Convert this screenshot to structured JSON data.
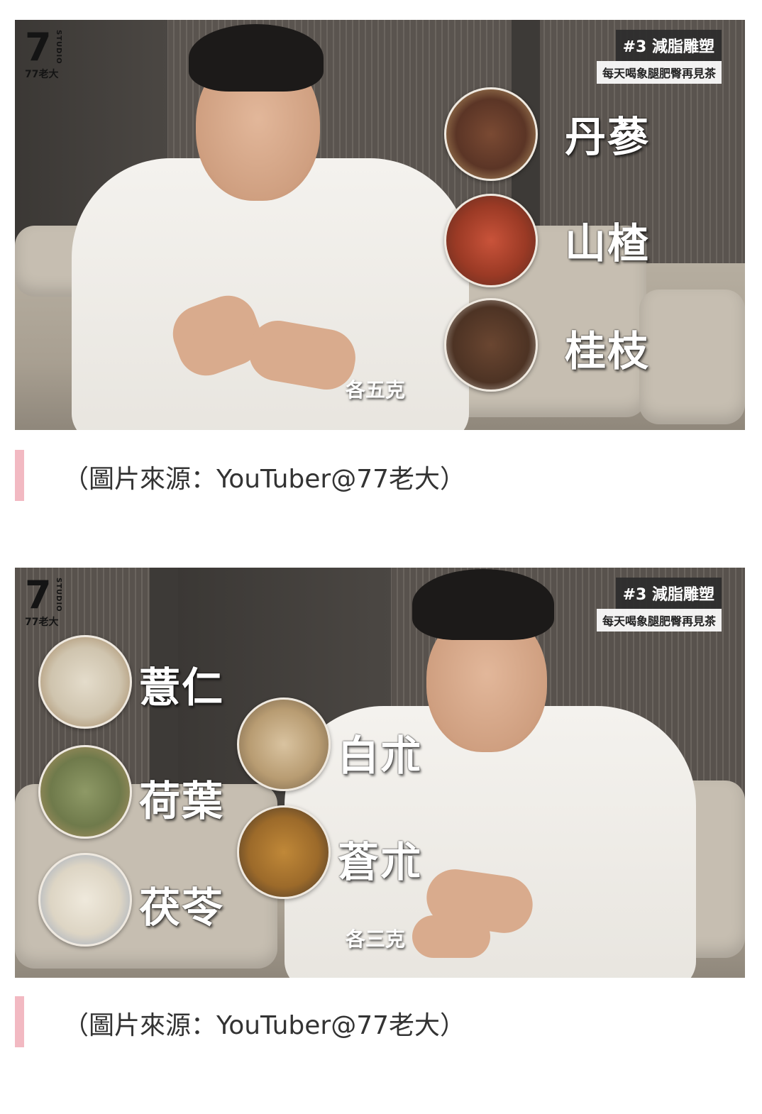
{
  "figures": [
    {
      "logo": {
        "mark": "7",
        "studio": "STUDIO",
        "name": "77老大"
      },
      "episode_tag": "#3 減脂雕塑",
      "subtitle_tag": "每天喝象腿肥臀再見茶",
      "herbs": [
        {
          "label": "丹蔘",
          "icon": "dried-danshen-icon",
          "color": "#6b3f2a"
        },
        {
          "label": "山楂",
          "icon": "dried-hawthorn-icon",
          "color": "#a9402b"
        },
        {
          "label": "桂枝",
          "icon": "cinnamon-twig-icon",
          "color": "#5c3b27"
        }
      ],
      "amount": "各五克"
    },
    {
      "logo": {
        "mark": "7",
        "studio": "STUDIO",
        "name": "77老大"
      },
      "episode_tag": "#3 減脂雕塑",
      "subtitle_tag": "每天喝象腿肥臀再見茶",
      "herbs_left": [
        {
          "label": "薏仁",
          "icon": "coix-seed-icon",
          "color": "#d9d0c0"
        },
        {
          "label": "荷葉",
          "icon": "lotus-leaf-icon",
          "color": "#7f8a58"
        },
        {
          "label": "茯苓",
          "icon": "poria-cube-icon",
          "color": "#e6e0d2"
        }
      ],
      "herbs_right": [
        {
          "label": "白朮",
          "icon": "atractylodes-slice-icon",
          "color": "#cbb48d"
        },
        {
          "label": "蒼朮",
          "icon": "cangzhu-slice-icon",
          "color": "#b87a2e"
        }
      ],
      "amount": "各三克"
    }
  ],
  "captions": [
    "（圖片來源：YouTuber@77老大）",
    "（圖片來源：YouTuber@77老大）"
  ]
}
